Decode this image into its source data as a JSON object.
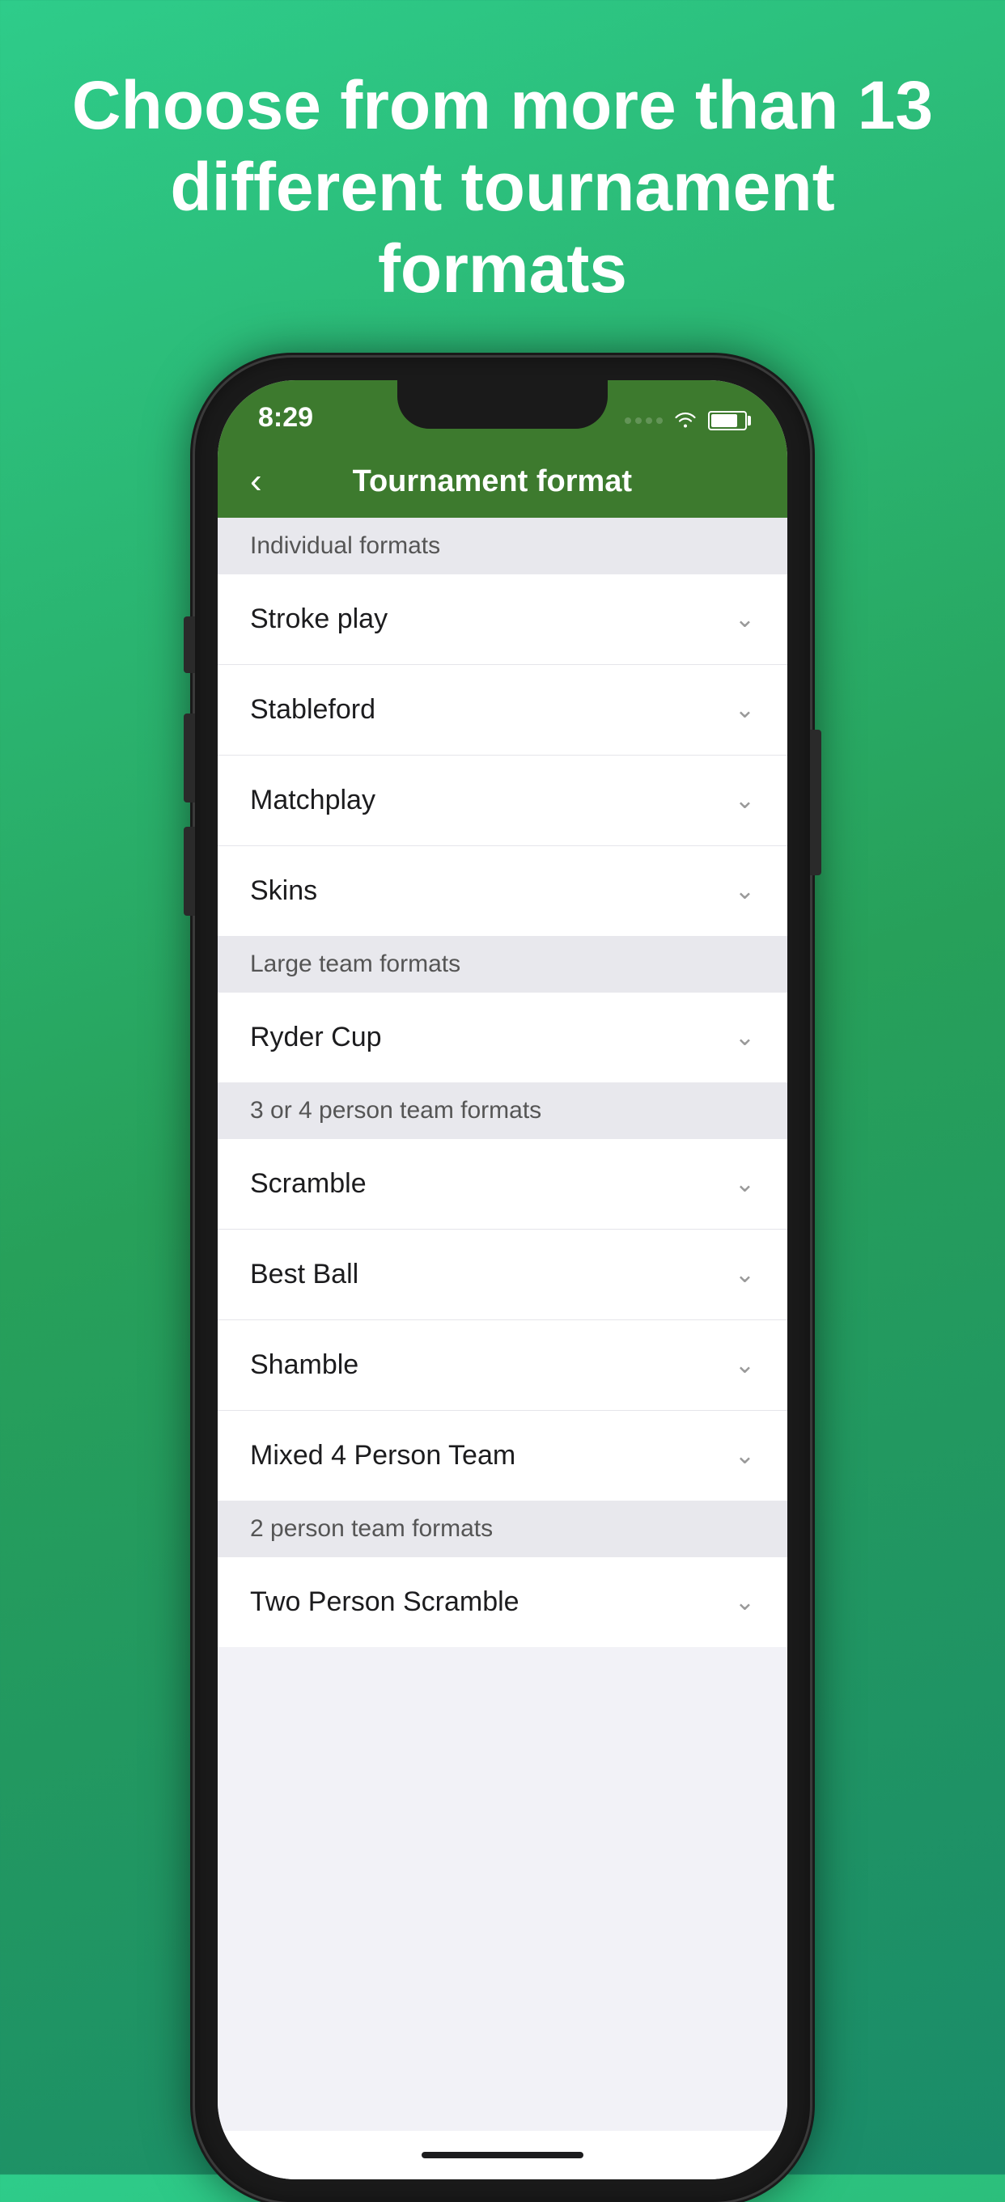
{
  "hero": {
    "text": "Choose from more than 13 different tournament formats"
  },
  "statusBar": {
    "time": "8:29"
  },
  "navBar": {
    "back_label": "‹",
    "title": "Tournament format"
  },
  "sections": [
    {
      "id": "individual",
      "header": "Individual formats",
      "items": [
        {
          "label": "Stroke play"
        },
        {
          "label": "Stableford"
        },
        {
          "label": "Matchplay"
        },
        {
          "label": "Skins"
        }
      ]
    },
    {
      "id": "large-team",
      "header": "Large team formats",
      "items": [
        {
          "label": "Ryder Cup"
        }
      ]
    },
    {
      "id": "3or4-team",
      "header": "3 or 4 person team formats",
      "items": [
        {
          "label": "Scramble"
        },
        {
          "label": "Best Ball"
        },
        {
          "label": "Shamble"
        },
        {
          "label": "Mixed 4 Person Team"
        }
      ]
    },
    {
      "id": "2person-team",
      "header": "2 person team formats",
      "items": [
        {
          "label": "Two Person Scramble"
        }
      ]
    }
  ],
  "icons": {
    "chevron": "⌄",
    "back": "‹",
    "wifi": "WiFi",
    "battery": "Battery"
  }
}
